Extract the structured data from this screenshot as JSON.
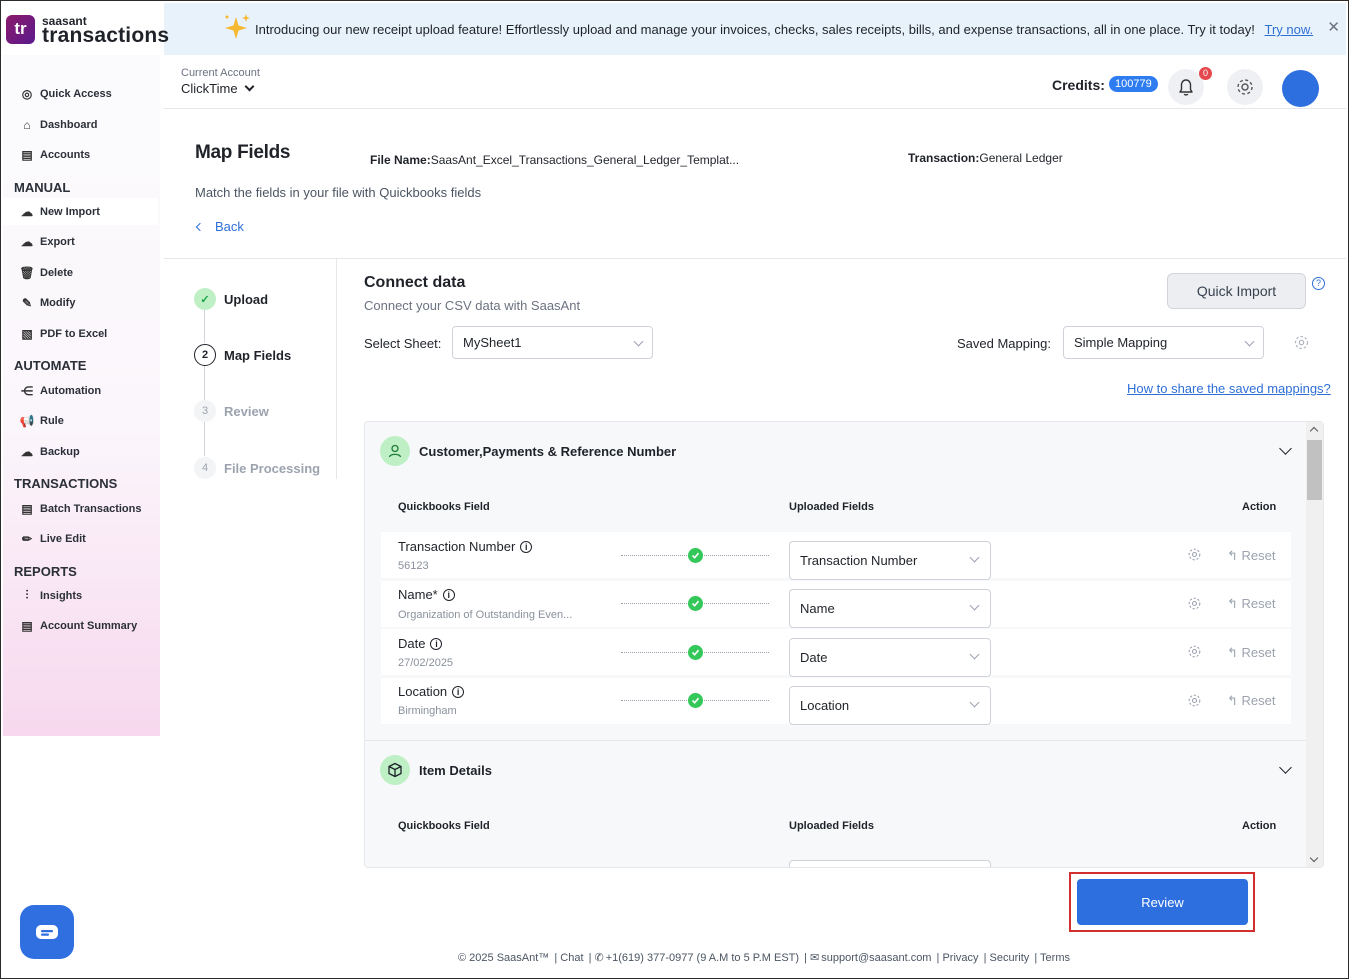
{
  "banner": {
    "message": "Introducing our new receipt upload feature! Effortlessly upload and manage your invoices, checks, sales receipts, bills, and expense transactions, all in one place. Try it today!",
    "link": "Try now.",
    "close": "✕"
  },
  "brand": {
    "small": "saasant",
    "large": "transactions",
    "mark": "tr"
  },
  "sidebar": {
    "items": [
      {
        "label": "Quick Access",
        "icon": "target-icon"
      },
      {
        "label": "Dashboard",
        "icon": "home-icon"
      },
      {
        "label": "Accounts",
        "icon": "clipboard-icon"
      }
    ],
    "manual_heading": "MANUAL",
    "manual": [
      {
        "label": "New Import",
        "icon": "upload-cloud-icon"
      },
      {
        "label": "Export",
        "icon": "download-cloud-icon"
      },
      {
        "label": "Delete",
        "icon": "trash-icon"
      },
      {
        "label": "Modify",
        "icon": "edit-file-icon"
      },
      {
        "label": "PDF to Excel",
        "icon": "pdf-icon"
      }
    ],
    "automate_heading": "AUTOMATE",
    "automate": [
      {
        "label": "Automation",
        "icon": "share-nodes-icon"
      },
      {
        "label": "Rule",
        "icon": "megaphone-icon"
      },
      {
        "label": "Backup",
        "icon": "cloud-backup-icon"
      }
    ],
    "transactions_heading": "TRANSACTIONS",
    "transactions": [
      {
        "label": "Batch Transactions",
        "icon": "document-icon"
      },
      {
        "label": "Live Edit",
        "icon": "pencil-icon"
      }
    ],
    "reports_heading": "REPORTS",
    "reports": [
      {
        "label": "Insights",
        "icon": "sliders-icon"
      },
      {
        "label": "Account Summary",
        "icon": "clipboard-icon"
      }
    ]
  },
  "header": {
    "account_label": "Current Account",
    "account_value": "ClickTime",
    "credits_label": "Credits:",
    "credits_value": "100779",
    "notifications": "0"
  },
  "page": {
    "title": "Map Fields",
    "file_label": "File Name:",
    "file_value": "SaasAnt_Excel_Transactions_General_Ledger_Templat...",
    "txn_label": "Transaction:",
    "txn_value": "General Ledger",
    "subtitle": "Match the fields in your file with Quickbooks fields",
    "back": "Back"
  },
  "steps": [
    {
      "num": "✓",
      "label": "Upload",
      "state": "done"
    },
    {
      "num": "2",
      "label": "Map Fields",
      "state": "current"
    },
    {
      "num": "3",
      "label": "Review",
      "state": "todo"
    },
    {
      "num": "4",
      "label": "File Processing",
      "state": "todo"
    }
  ],
  "connect": {
    "title": "Connect data",
    "subtitle": "Connect your CSV data with SaasAnt",
    "quick_import": "Quick Import",
    "help": "?",
    "sheet_label": "Select Sheet:",
    "sheet_value": "MySheet1",
    "mapping_label": "Saved Mapping:",
    "mapping_value": "Simple Mapping",
    "share_link": "How to share the saved mappings?"
  },
  "sections": [
    {
      "title": "Customer,Payments & Reference Number",
      "icon": "user-icon",
      "col_qb": "Quickbooks Field",
      "col_up": "Uploaded Fields",
      "col_action": "Action",
      "rows": [
        {
          "field": "Transaction Number",
          "sample": "56123",
          "uploaded": "Transaction Number",
          "reset": "Reset"
        },
        {
          "field": "Name*",
          "sample": "Organization of Outstanding Even...",
          "uploaded": "Name",
          "reset": "Reset"
        },
        {
          "field": "Date",
          "sample": "27/02/2025",
          "uploaded": "Date",
          "reset": "Reset"
        },
        {
          "field": "Location",
          "sample": "Birmingham",
          "uploaded": "Location",
          "reset": "Reset"
        }
      ]
    },
    {
      "title": "Item Details",
      "icon": "box-icon",
      "col_qb": "Quickbooks Field",
      "col_up": "Uploaded Fields",
      "col_action": "Action"
    }
  ],
  "review_button": "Review",
  "footer": {
    "copyright": "© 2025 SaasAnt™",
    "chat": "Chat",
    "phone": "+1(619) 377-0977 (9 A.M to 5 P.M EST)",
    "email": "support@saasant.com",
    "privacy": "Privacy",
    "security": "Security",
    "terms": "Terms"
  }
}
